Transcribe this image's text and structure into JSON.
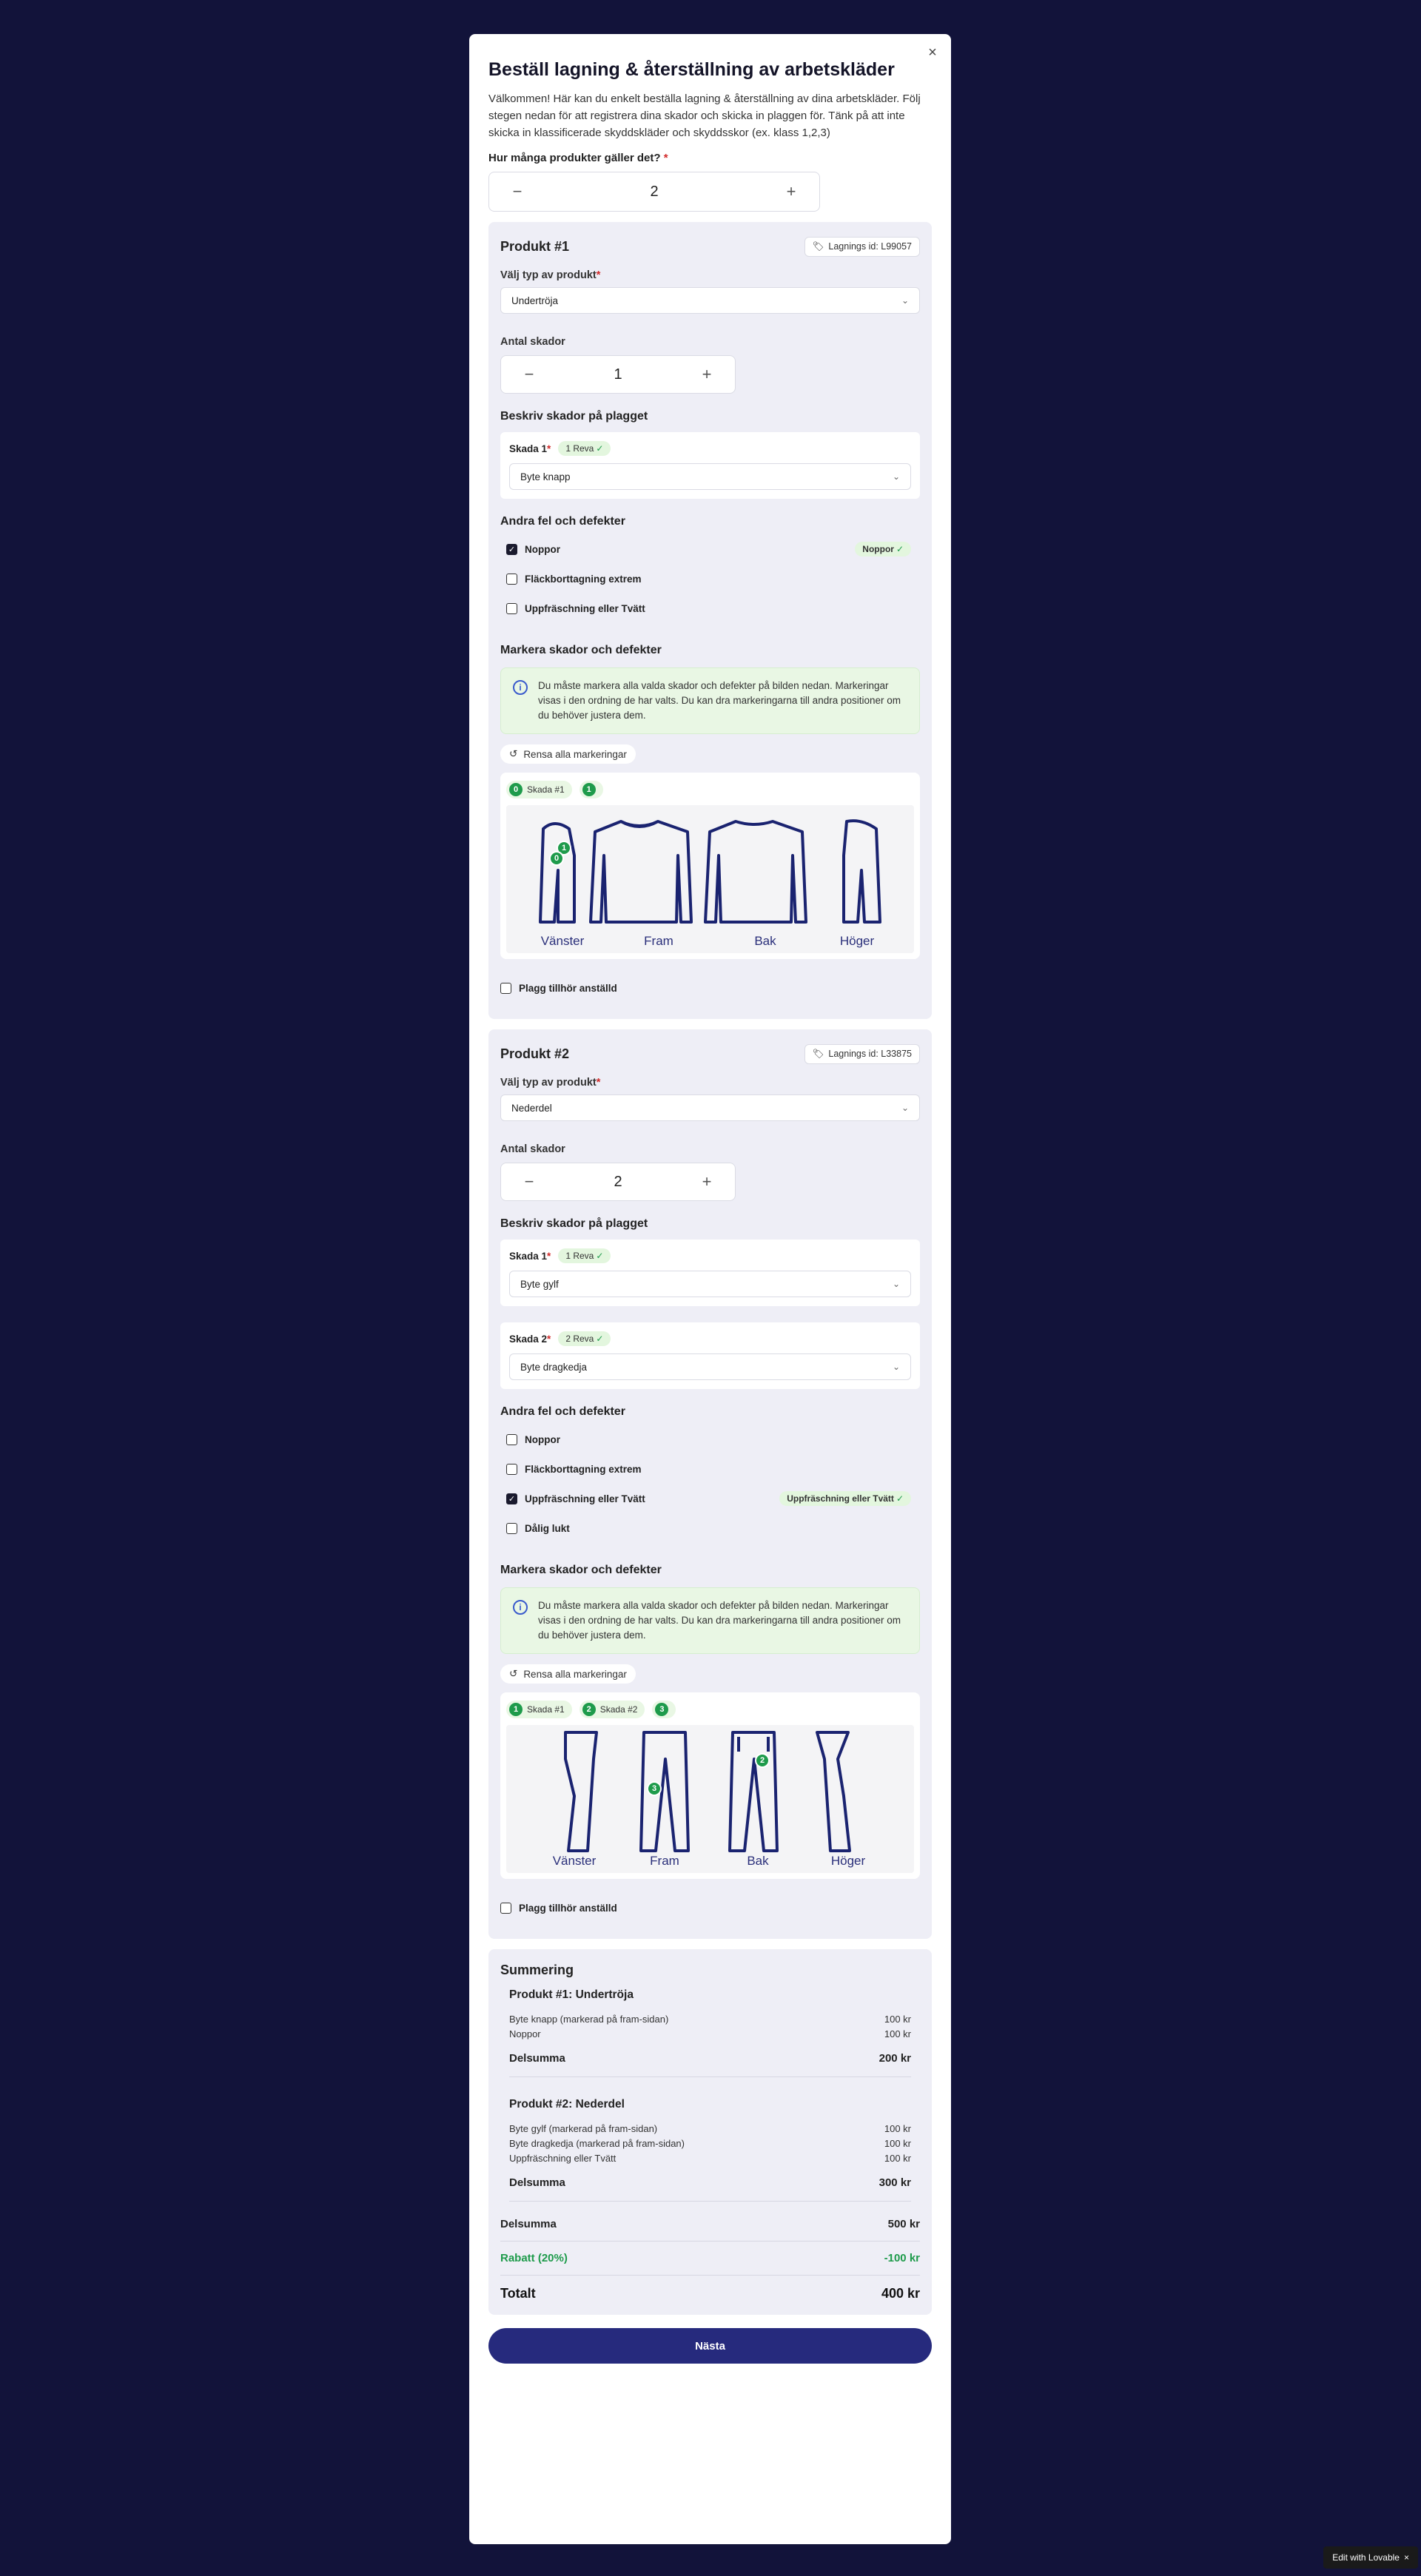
{
  "modal": {
    "title": "Beställ lagning & återställning av arbetskläder",
    "intro": "Välkommen! Här kan du enkelt beställa lagning & återställning av dina arbetskläder. Följ stegen nedan för att registrera dina skador och skicka in plaggen för. Tänk på att inte skicka in klassificerade skyddskläder och skyddsskor (ex. klass 1,2,3)",
    "question": "Hur många produkter gäller det?",
    "required": "*",
    "count": "2",
    "close": "×"
  },
  "labels": {
    "type": "Välj typ av produkt",
    "antal": "Antal skador",
    "describe": "Beskriv skador på plagget",
    "other": "Andra fel och defekter",
    "mark": "Markera skador och defekter",
    "info": "Du måste markera alla valda skador och defekter på bilden nedan. Markeringar visas i den ordning de har valts. Du kan dra markeringarna till andra positioner om du behöver justera dem.",
    "reset": "Rensa alla markeringar",
    "plagg": "Plagg tillhör anställd",
    "views": [
      "Vänster",
      "Fram",
      "Bak",
      "Höger"
    ]
  },
  "product1": {
    "title": "Produkt #1",
    "lagid": "Lagnings id: L99057",
    "type": "Undertröja",
    "antal": "1",
    "damage1": {
      "label": "Skada 1",
      "pill": "1 Reva",
      "value": "Byte knapp"
    },
    "defects": [
      {
        "label": "Noppor",
        "checked": true,
        "pill": "Noppor"
      },
      {
        "label": "Fläckborttagning extrem",
        "checked": false
      },
      {
        "label": "Uppfräschning eller Tvätt",
        "checked": false
      }
    ],
    "tags": [
      {
        "num": "0",
        "label": "Skada #1"
      },
      {
        "num": "1",
        "label": ""
      }
    ],
    "pins": [
      "1",
      "0"
    ]
  },
  "product2": {
    "title": "Produkt #2",
    "lagid": "Lagnings id: L33875",
    "type": "Nederdel",
    "antal": "2",
    "damage1": {
      "label": "Skada 1",
      "pill": "1 Reva",
      "value": "Byte gylf"
    },
    "damage2": {
      "label": "Skada 2",
      "pill": "2 Reva",
      "value": "Byte dragkedja"
    },
    "defects": [
      {
        "label": "Noppor",
        "checked": false
      },
      {
        "label": "Fläckborttagning extrem",
        "checked": false
      },
      {
        "label": "Uppfräschning eller Tvätt",
        "checked": true,
        "pill": "Uppfräschning eller Tvätt"
      },
      {
        "label": "Dålig lukt",
        "checked": false
      }
    ],
    "tags": [
      {
        "num": "1",
        "label": "Skada #1"
      },
      {
        "num": "2",
        "label": "Skada #2"
      },
      {
        "num": "3",
        "label": ""
      }
    ],
    "pins": [
      "2",
      "3"
    ]
  },
  "summary": {
    "title": "Summering",
    "p1": {
      "title": "Produkt #1: Undertröja",
      "lines": [
        {
          "name": "Byte knapp (markerad på fram-sidan)",
          "price": "100 kr"
        },
        {
          "name": "Noppor",
          "price": "100 kr"
        }
      ],
      "sub_label": "Delsumma",
      "sub": "200 kr"
    },
    "p2": {
      "title": "Produkt #2: Nederdel",
      "lines": [
        {
          "name": "Byte gylf (markerad på fram-sidan)",
          "price": "100 kr"
        },
        {
          "name": "Byte dragkedja (markerad på fram-sidan)",
          "price": "100 kr"
        },
        {
          "name": "Uppfräschning eller Tvätt",
          "price": "100 kr"
        }
      ],
      "sub_label": "Delsumma",
      "sub": "300 kr"
    },
    "delsumma_label": "Delsumma",
    "delsumma": "500 kr",
    "rabatt_label": "Rabatt (20%)",
    "rabatt": "-100 kr",
    "total_label": "Totalt",
    "total": "400 kr"
  },
  "next": "Nästa",
  "badge": "Edit with  Lovable",
  "colors": {
    "accent": "#262a7d",
    "green": "#1e9b4b",
    "bg": "#12133a"
  }
}
